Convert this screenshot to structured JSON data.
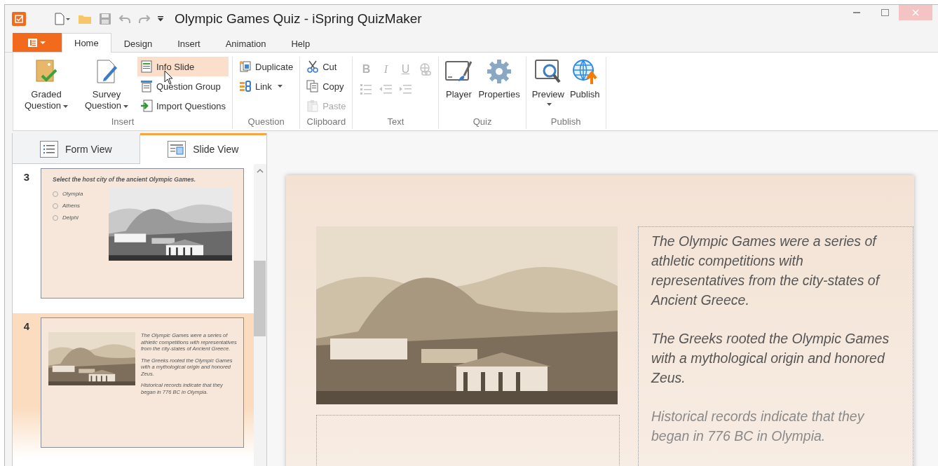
{
  "window": {
    "title": "Olympic Games Quiz - iSpring QuizMaker"
  },
  "ribbon_tabs": [
    {
      "label": "Home",
      "selected": true
    },
    {
      "label": "Design",
      "selected": false
    },
    {
      "label": "Insert",
      "selected": false
    },
    {
      "label": "Animation",
      "selected": false
    },
    {
      "label": "Help",
      "selected": false
    }
  ],
  "ribbon_groups": [
    {
      "label": "Insert",
      "items": [
        {
          "kind": "large",
          "label": "Graded Question",
          "dropdown": true,
          "disabled": false,
          "hovered": false
        },
        {
          "kind": "large",
          "label": "Survey Question",
          "dropdown": true,
          "disabled": false,
          "hovered": false
        },
        {
          "kind": "small",
          "label": "Info Slide",
          "dropdown": false,
          "disabled": false,
          "hovered": true
        },
        {
          "kind": "small",
          "label": "Question Group",
          "dropdown": false,
          "disabled": false,
          "hovered": false
        },
        {
          "kind": "small",
          "label": "Import Questions",
          "dropdown": false,
          "disabled": false,
          "hovered": false
        }
      ]
    },
    {
      "label": "Question",
      "items": [
        {
          "kind": "small",
          "label": "Duplicate",
          "dropdown": false,
          "disabled": false,
          "hovered": false
        },
        {
          "kind": "small",
          "label": "Link",
          "dropdown": true,
          "disabled": false,
          "hovered": false
        }
      ]
    },
    {
      "label": "Clipboard",
      "items": [
        {
          "kind": "small",
          "label": "Cut",
          "dropdown": false,
          "disabled": false,
          "hovered": false
        },
        {
          "kind": "small",
          "label": "Copy",
          "dropdown": false,
          "disabled": false,
          "hovered": false
        },
        {
          "kind": "small",
          "label": "Paste",
          "dropdown": false,
          "disabled": true,
          "hovered": false
        }
      ]
    },
    {
      "label": "Text",
      "items": [
        {
          "kind": "glyph",
          "label": "B",
          "dropdown": false,
          "disabled": true,
          "hovered": false
        },
        {
          "kind": "glyph",
          "label": "I",
          "dropdown": false,
          "disabled": true,
          "hovered": false
        },
        {
          "kind": "glyph",
          "label": "U",
          "dropdown": false,
          "disabled": true,
          "hovered": false
        },
        {
          "kind": "tiny",
          "dropdown": false,
          "disabled": true,
          "hovered": false
        },
        {
          "kind": "tiny",
          "dropdown": false,
          "disabled": true,
          "hovered": false
        },
        {
          "kind": "tiny",
          "dropdown": false,
          "disabled": true,
          "hovered": false
        },
        {
          "kind": "tiny",
          "dropdown": false,
          "disabled": true,
          "hovered": false
        }
      ]
    },
    {
      "label": "Quiz",
      "items": [
        {
          "kind": "large",
          "label": "Player",
          "dropdown": false,
          "disabled": false,
          "hovered": false
        },
        {
          "kind": "large",
          "label": "Properties",
          "dropdown": false,
          "disabled": false,
          "hovered": false
        }
      ]
    },
    {
      "label": "Publish",
      "items": [
        {
          "kind": "large",
          "label": "Preview",
          "dropdown": true,
          "disabled": false,
          "hovered": false
        },
        {
          "kind": "large",
          "label": "Publish",
          "dropdown": false,
          "disabled": false,
          "hovered": false
        }
      ]
    }
  ],
  "view_tabs": [
    {
      "label": "Form View",
      "selected": false
    },
    {
      "label": "Slide View",
      "selected": true
    }
  ],
  "slides": [
    {
      "number": "3",
      "kind": "question",
      "selected": false,
      "question": "Select the host city of the ancient Olympic Games.",
      "options": [
        "Olympia",
        "Athens",
        "Delphi"
      ]
    },
    {
      "number": "4",
      "kind": "info",
      "selected": true,
      "paragraphs": [
        "The Olympic Games were a series of athletic competitions with representatives from the city-states of Ancient Greece.",
        "The Greeks rooted the Olympic Games with a mythological origin and honored Zeus.",
        "Historical records indicate that they began in 776 BC in Olympia."
      ]
    }
  ],
  "current_slide": {
    "paragraphs": [
      "The Olympic Games were a series of athletic competitions with representatives from the city-states of Ancient Greece.",
      "The Greeks rooted the Olympic Games with a mythological origin and honored Zeus.",
      "Historical records indicate that they began in 776 BC in Olympia."
    ]
  }
}
